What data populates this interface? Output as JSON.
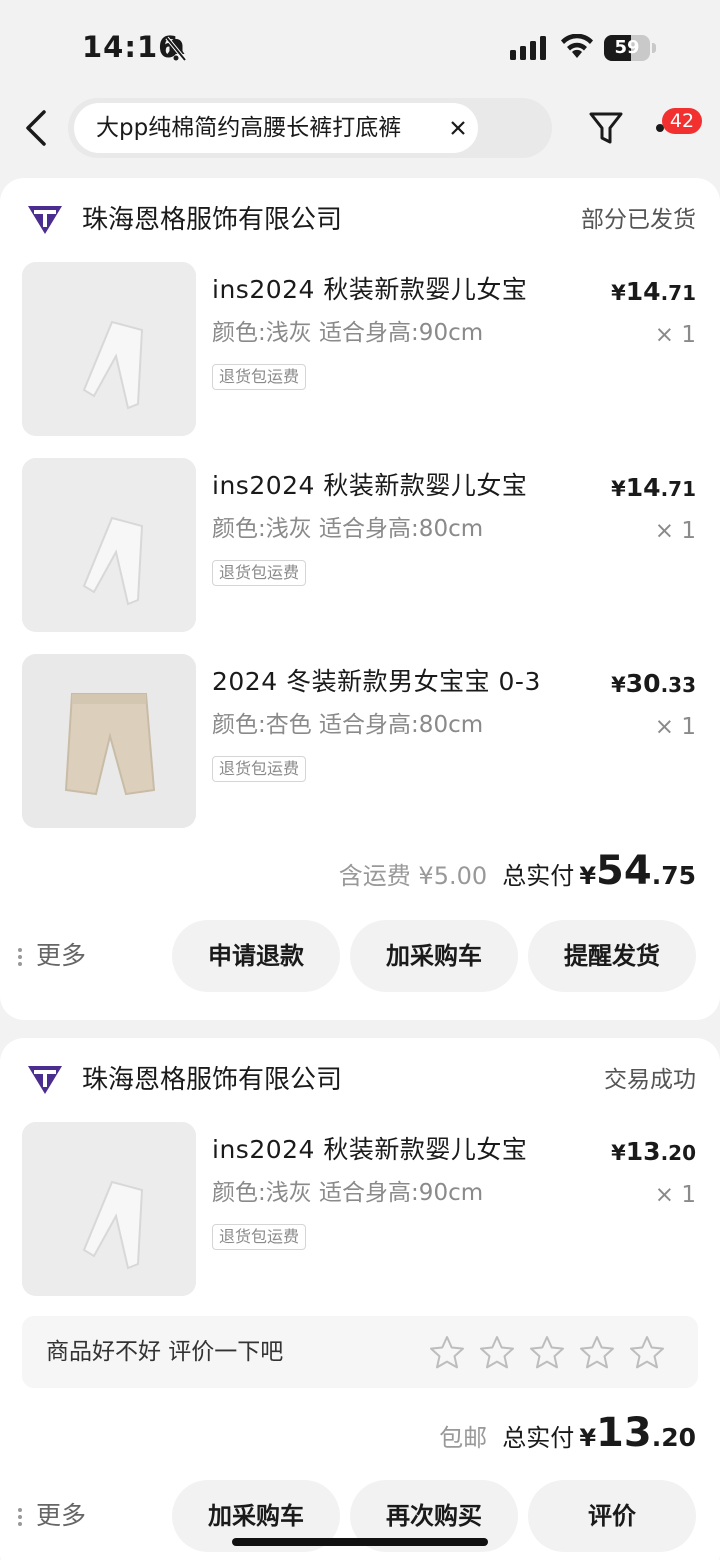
{
  "status_bar": {
    "time": "14:16",
    "battery_level": "59",
    "icons": [
      "bell-slash-icon",
      "signal-icon",
      "wifi-icon",
      "battery-icon"
    ]
  },
  "nav": {
    "search_query": "大pp纯棉简约高腰长裤打底裤",
    "notification_count": "42",
    "icons": [
      "back-icon",
      "clear-icon",
      "filter-icon",
      "more-icon"
    ]
  },
  "orders": [
    {
      "shop_name": "珠海恩格服饰有限公司",
      "status": "部分已发货",
      "items": [
        {
          "title": "ins2024 秋装新款婴儿女宝",
          "spec": "颜色:浅灰 适合身高:90cm",
          "tag": "退货包运费",
          "price_symbol": "¥",
          "price_int": "14",
          "price_dec": ".71",
          "qty": "× 1",
          "image": "light-grey-pants"
        },
        {
          "title": "ins2024 秋装新款婴儿女宝",
          "spec": "颜色:浅灰 适合身高:80cm",
          "tag": "退货包运费",
          "price_symbol": "¥",
          "price_int": "14",
          "price_dec": ".71",
          "qty": "× 1",
          "image": "light-grey-pants"
        },
        {
          "title": "2024 冬装新款男女宝宝 0-3",
          "spec": "颜色:杏色 适合身高:80cm",
          "tag": "退货包运费",
          "price_symbol": "¥",
          "price_int": "30",
          "price_dec": ".33",
          "qty": "× 1",
          "image": "apricot-pants"
        }
      ],
      "shipping": "含运费 ¥5.00",
      "total_label": "总实付",
      "total_symbol": "¥",
      "total_int": "54",
      "total_dec": ".75",
      "more_label": "更多",
      "buttons": [
        "申请退款",
        "加采购车",
        "提醒发货"
      ]
    },
    {
      "shop_name": "珠海恩格服饰有限公司",
      "status": "交易成功",
      "items": [
        {
          "title": "ins2024 秋装新款婴儿女宝",
          "spec": "颜色:浅灰 适合身高:90cm",
          "tag": "退货包运费",
          "price_symbol": "¥",
          "price_int": "13",
          "price_dec": ".20",
          "qty": "× 1",
          "image": "light-grey-pants"
        }
      ],
      "review_prompt": "商品好不好 评价一下吧",
      "review_stars": 5,
      "shipping": "包邮",
      "total_label": "总实付",
      "total_symbol": "¥",
      "total_int": "13",
      "total_dec": ".20",
      "more_label": "更多",
      "buttons": [
        "加采购车",
        "再次购买",
        "评价"
      ]
    }
  ],
  "colors": {
    "badge": "#f23030",
    "page_bg": "#f2f2f2",
    "shop_logo": "#4b2c8f"
  }
}
